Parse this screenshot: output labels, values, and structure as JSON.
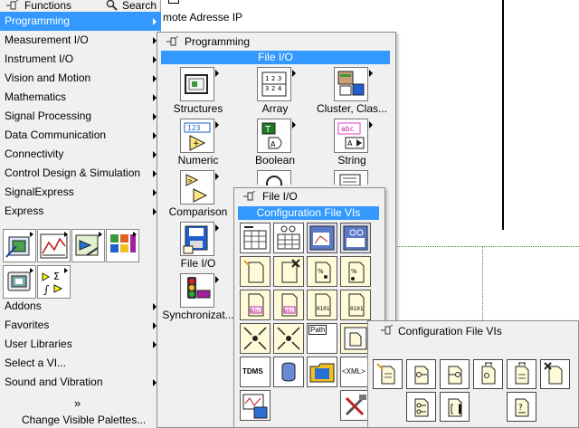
{
  "background": {
    "label_top": "mote Adresse IP"
  },
  "functions_palette": {
    "title": "Functions",
    "search_label": "Search",
    "items": [
      {
        "label": "Programming",
        "selected": true,
        "submenu": true
      },
      {
        "label": "Measurement I/O",
        "submenu": true
      },
      {
        "label": "Instrument I/O",
        "submenu": true
      },
      {
        "label": "Vision and Motion",
        "submenu": true
      },
      {
        "label": "Mathematics",
        "submenu": true
      },
      {
        "label": "Signal Processing",
        "submenu": true
      },
      {
        "label": "Data Communication",
        "submenu": true
      },
      {
        "label": "Connectivity",
        "submenu": true
      },
      {
        "label": "Control Design & Simulation",
        "submenu": true
      },
      {
        "label": "SignalExpress",
        "submenu": true
      },
      {
        "label": "Express",
        "submenu": true
      }
    ],
    "items_lower": [
      {
        "label": "Addons",
        "submenu": true
      },
      {
        "label": "Favorites",
        "submenu": true
      },
      {
        "label": "User Libraries",
        "submenu": true
      },
      {
        "label": "Select a VI...",
        "submenu": false
      },
      {
        "label": "Sound and Vibration",
        "submenu": true
      }
    ],
    "expand_glyph": "»",
    "change_palettes": "Change Visible Palettes...",
    "quick_icons": [
      "express-input-icon",
      "express-signal-icon",
      "express-exec-icon",
      "express-arith-icon",
      "express-output-icon",
      "express-math-icon"
    ]
  },
  "programming_menu": {
    "title": "Programming",
    "highlight": "File I/O",
    "tiles": [
      {
        "label": "Structures",
        "icon": "structures-icon"
      },
      {
        "label": "Array",
        "icon": "array-icon"
      },
      {
        "label": "Cluster, Clas...",
        "icon": "cluster-icon"
      },
      {
        "label": "Numeric",
        "icon": "numeric-icon"
      },
      {
        "label": "Boolean",
        "icon": "boolean-icon"
      },
      {
        "label": "String",
        "icon": "string-icon"
      },
      {
        "label": "Comparison",
        "icon": "comparison-icon"
      },
      {
        "label": "File I/O",
        "icon": "file-io-icon"
      },
      {
        "label": "Synchronizat...",
        "icon": "synchronization-icon"
      }
    ]
  },
  "file_io_menu": {
    "title": "File I/O",
    "highlight": "Configuration File VIs",
    "tag_path": "Path",
    "tag_tdms": "TDMS",
    "tag_xml": "<XML>"
  },
  "config_menu": {
    "title": "Configuration File VIs"
  },
  "colors": {
    "selection": "#3399ff",
    "palette_bg": "#f0f0f0",
    "file_tile_bg": "#fffbd8"
  }
}
